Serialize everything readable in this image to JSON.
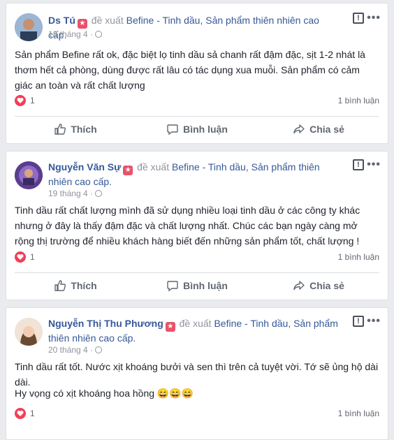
{
  "posts": [
    {
      "author": "Ds Tú",
      "recommends": "đề xuất",
      "page": "Befine - Tinh dầu, Sản phẩm thiên nhiên cao cấp.",
      "date": "18 tháng 4 ·",
      "text": "Sản phẩm Befine rất ok, đặc biệt lọ tinh dầu sả chanh rất đậm đặc, sịt 1-2 nhát là thơm hết cả phòng, dùng được rất lâu có tác dụng xua muỗi. Sản phẩm có cảm giác an toàn và rất chất lượng",
      "likes": "1",
      "comments": "1 bình luận",
      "avatar_color": "#6d8fb5"
    },
    {
      "author": "Nguyễn Văn Sự",
      "recommends": "đề xuất",
      "page": "Befine - Tinh dầu, Sản phẩm thiên nhiên cao cấp.",
      "date": "19 tháng 4 ·",
      "text": "Tinh dầu rất chất lượng mình đã sử dụng nhiều loại tinh dầu ở các công ty khác nhưng ở đây là thấy đậm đặc và chất lượng nhất. Chúc các bạn ngày càng mở rộng thị trường để nhiều khách hàng biết đến những sản phẩm tốt, chất lượng !",
      "likes": "1",
      "comments": "1 bình luận",
      "avatar_color": "#6b4fa0"
    },
    {
      "author": "Nguyễn Thị Thu Phương",
      "recommends": "đề xuất",
      "page": "Befine - Tinh dầu, Sản phẩm thiên nhiên cao cấp.",
      "date": "20 tháng 4 ·",
      "text": "Tinh dầu rất tốt. Nước xịt khoáng bưởi và sen thì trên cả tuyệt vời. Tớ sẽ ủng hộ dài dài.",
      "text2": "Hy vọng có xịt khoáng hoa hồng 😄😄😄",
      "likes": "1",
      "comments": "1 bình luận",
      "avatar_color": "#e8c9b0"
    }
  ],
  "actions": {
    "like": "Thích",
    "comment": "Bình luận",
    "share": "Chia sẻ"
  },
  "colors": {
    "accent": "#365899",
    "heart": "#f33e58",
    "badge": "#e9536a"
  }
}
